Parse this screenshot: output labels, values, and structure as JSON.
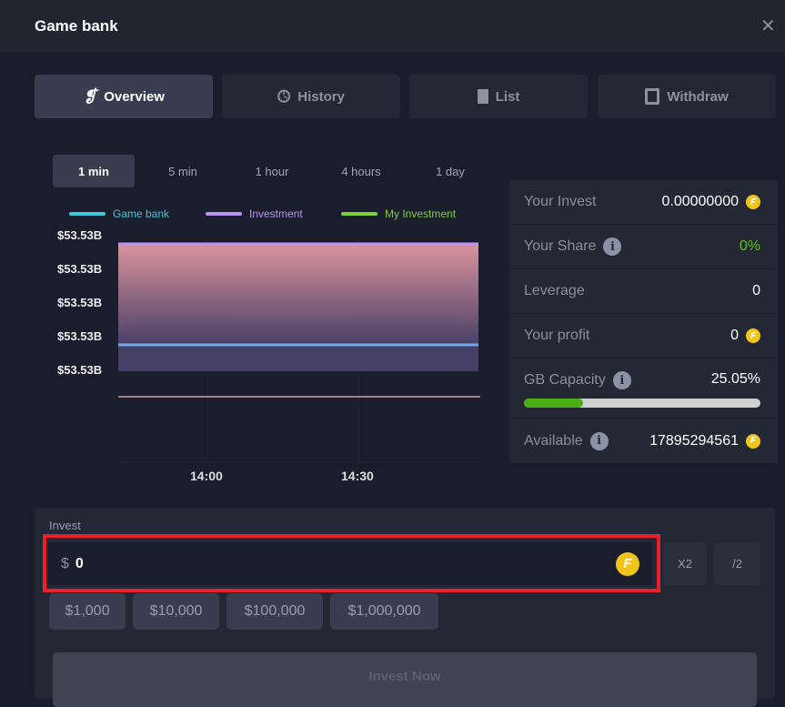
{
  "header": {
    "title": "Game bank",
    "close_icon": "close-icon"
  },
  "tabs": [
    {
      "label": "Overview",
      "icon": "overview-icon",
      "active": true
    },
    {
      "label": "History",
      "icon": "clock-icon"
    },
    {
      "label": "List",
      "icon": "document-icon"
    },
    {
      "label": "Withdraw",
      "icon": "atm-icon"
    }
  ],
  "ranges": [
    {
      "label": "1 min",
      "active": true
    },
    {
      "label": "5 min"
    },
    {
      "label": "1 hour"
    },
    {
      "label": "4 hours"
    },
    {
      "label": "1 day"
    }
  ],
  "chart_data": {
    "type": "area",
    "legend": [
      {
        "name": "Game bank",
        "color": "#3fc6e0"
      },
      {
        "name": "Investment",
        "color": "#b794f6"
      },
      {
        "name": "My Investment",
        "color": "#7ed03a"
      }
    ],
    "legend_placement": "top",
    "y_ticks": [
      "$53.53B",
      "$53.53B",
      "$53.53B",
      "$53.53B",
      "$53.53B"
    ],
    "x_ticks": [
      "14:00",
      "14:30"
    ],
    "grid": true
  },
  "stats": {
    "your_invest": {
      "label": "Your Invest",
      "value": "0.00000000"
    },
    "your_share": {
      "label": "Your Share",
      "value": "0%",
      "color": "#5cbf1e"
    },
    "leverage": {
      "label": "Leverage",
      "value": "0"
    },
    "your_profit": {
      "label": "Your profit",
      "value": "0"
    },
    "gb_capacity": {
      "label": "GB Capacity",
      "value": "25.05%",
      "fill_percent": 25.05
    },
    "available": {
      "label": "Available",
      "value": "17895294561"
    }
  },
  "invest": {
    "label": "Invest",
    "currency": "$",
    "value": "0",
    "x2": "X2",
    "half": "/2",
    "presets": [
      "$1,000",
      "$10,000",
      "$100,000",
      "$1,000,000"
    ],
    "submit": "Invest Now",
    "highlight_color": "#e8202a"
  }
}
